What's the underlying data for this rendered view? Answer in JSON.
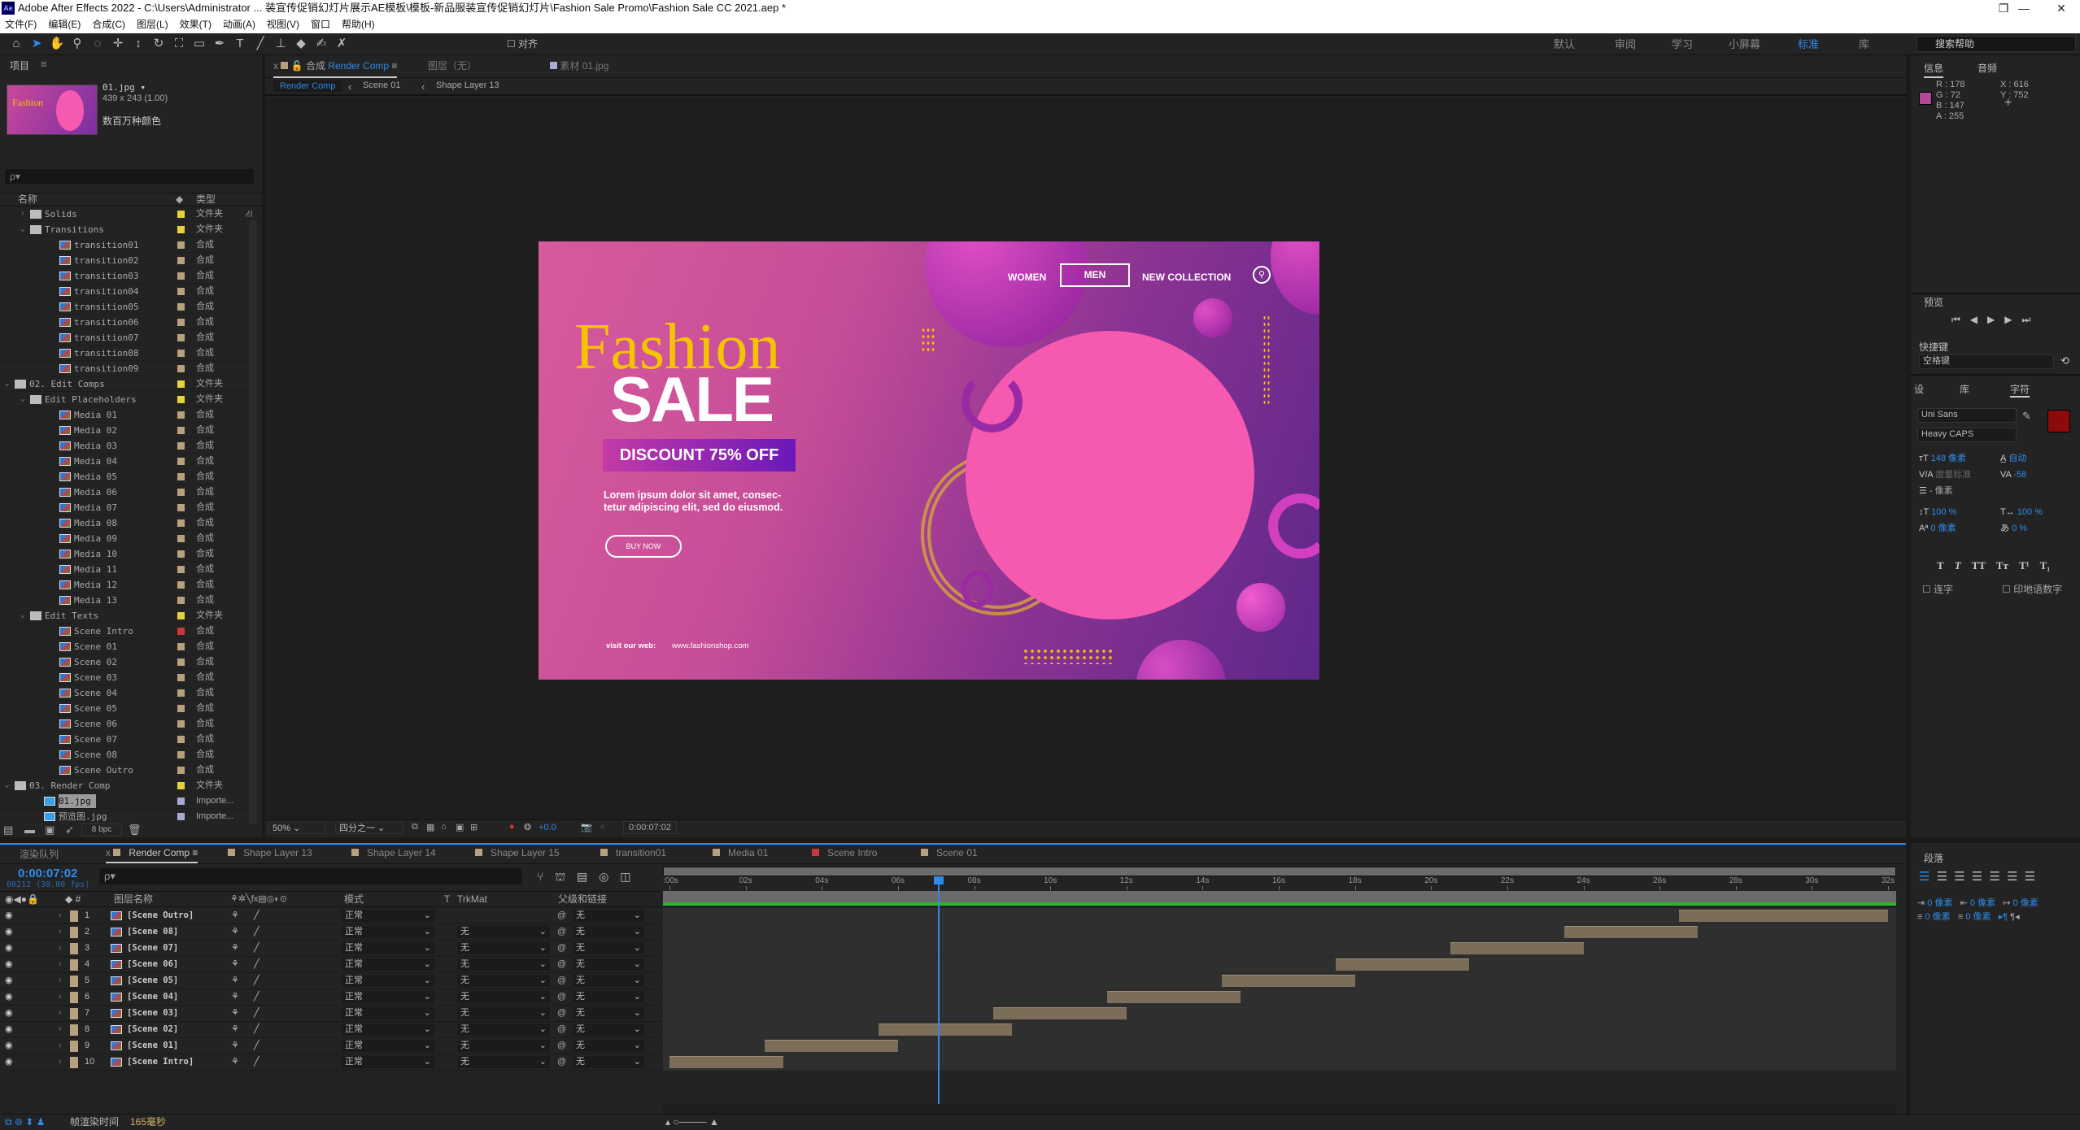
{
  "window": {
    "title": "Adobe After Effects 2022 - C:\\Users\\Administrator ... 装宣传促销幻灯片展示AE模板\\模板-新品服装宣传促销幻灯片\\Fashion Sale Promo\\Fashion Sale CC 2021.aep *",
    "logo": "Ae",
    "controls": [
      "—",
      "❐",
      "✕"
    ]
  },
  "menu": [
    "文件(F)",
    "编辑(E)",
    "合成(C)",
    "图层(L)",
    "效果(T)",
    "动画(A)",
    "视图(V)",
    "窗口",
    "帮助(H)"
  ],
  "toolbar": {
    "align_label": "对齐",
    "workspaces": [
      "默认",
      "审阅",
      "学习",
      "小屏幕",
      "标准",
      "库"
    ],
    "active_workspace": "标准",
    "help_placeholder": "搜索帮助"
  },
  "project": {
    "title": "项目",
    "thumb_name": "01.jpg ▾",
    "thumb_dims": "439 x 243 (1.00)",
    "thumb_colors": "数百万种颜色",
    "search_placeholder": "ρ▾",
    "col_name": "名称",
    "col_type": "类型",
    "bpc": "8 bpc",
    "items": [
      {
        "name": "Solids",
        "kind": "folder",
        "depth": 1,
        "open": false,
        "label": "#e6d23c",
        "type": "文件夹"
      },
      {
        "name": "Transitions",
        "kind": "folder",
        "depth": 1,
        "open": true,
        "label": "#e6d23c",
        "type": "文件夹"
      },
      {
        "name": "transition01",
        "kind": "comp",
        "depth": 2,
        "label": "#b7a17e",
        "type": "合成"
      },
      {
        "name": "transition02",
        "kind": "comp",
        "depth": 2,
        "label": "#b7a17e",
        "type": "合成"
      },
      {
        "name": "transition03",
        "kind": "comp",
        "depth": 2,
        "label": "#b7a17e",
        "type": "合成"
      },
      {
        "name": "transition04",
        "kind": "comp",
        "depth": 2,
        "label": "#b7a17e",
        "type": "合成"
      },
      {
        "name": "transition05",
        "kind": "comp",
        "depth": 2,
        "label": "#b7a17e",
        "type": "合成"
      },
      {
        "name": "transition06",
        "kind": "comp",
        "depth": 2,
        "label": "#b7a17e",
        "type": "合成"
      },
      {
        "name": "transition07",
        "kind": "comp",
        "depth": 2,
        "label": "#b7a17e",
        "type": "合成"
      },
      {
        "name": "transition08",
        "kind": "comp",
        "depth": 2,
        "label": "#b7a17e",
        "type": "合成"
      },
      {
        "name": "transition09",
        "kind": "comp",
        "depth": 2,
        "label": "#b7a17e",
        "type": "合成"
      },
      {
        "name": "02. Edit Comps",
        "kind": "folder",
        "depth": 0,
        "open": true,
        "label": "#e6d23c",
        "type": "文件夹"
      },
      {
        "name": "Edit Placeholders",
        "kind": "folder",
        "depth": 1,
        "open": true,
        "label": "#e6d23c",
        "type": "文件夹"
      },
      {
        "name": "Media 01",
        "kind": "comp",
        "depth": 2,
        "label": "#b7a17e",
        "type": "合成"
      },
      {
        "name": "Media 02",
        "kind": "comp",
        "depth": 2,
        "label": "#b7a17e",
        "type": "合成"
      },
      {
        "name": "Media 03",
        "kind": "comp",
        "depth": 2,
        "label": "#b7a17e",
        "type": "合成"
      },
      {
        "name": "Media 04",
        "kind": "comp",
        "depth": 2,
        "label": "#b7a17e",
        "type": "合成"
      },
      {
        "name": "Media 05",
        "kind": "comp",
        "depth": 2,
        "label": "#b7a17e",
        "type": "合成"
      },
      {
        "name": "Media 06",
        "kind": "comp",
        "depth": 2,
        "label": "#b7a17e",
        "type": "合成"
      },
      {
        "name": "Media 07",
        "kind": "comp",
        "depth": 2,
        "label": "#b7a17e",
        "type": "合成"
      },
      {
        "name": "Media 08",
        "kind": "comp",
        "depth": 2,
        "label": "#b7a17e",
        "type": "合成"
      },
      {
        "name": "Media 09",
        "kind": "comp",
        "depth": 2,
        "label": "#b7a17e",
        "type": "合成"
      },
      {
        "name": "Media 10",
        "kind": "comp",
        "depth": 2,
        "label": "#b7a17e",
        "type": "合成"
      },
      {
        "name": "Media 11",
        "kind": "comp",
        "depth": 2,
        "label": "#b7a17e",
        "type": "合成"
      },
      {
        "name": "Media 12",
        "kind": "comp",
        "depth": 2,
        "label": "#b7a17e",
        "type": "合成"
      },
      {
        "name": "Media 13",
        "kind": "comp",
        "depth": 2,
        "label": "#b7a17e",
        "type": "合成"
      },
      {
        "name": "Edit Texts",
        "kind": "folder",
        "depth": 1,
        "open": true,
        "label": "#e6d23c",
        "type": "文件夹"
      },
      {
        "name": "Scene Intro",
        "kind": "comp",
        "depth": 2,
        "label": "#c43a3a",
        "type": "合成"
      },
      {
        "name": "Scene 01",
        "kind": "comp",
        "depth": 2,
        "label": "#b7a17e",
        "type": "合成"
      },
      {
        "name": "Scene 02",
        "kind": "comp",
        "depth": 2,
        "label": "#b7a17e",
        "type": "合成"
      },
      {
        "name": "Scene 03",
        "kind": "comp",
        "depth": 2,
        "label": "#b7a17e",
        "type": "合成"
      },
      {
        "name": "Scene 04",
        "kind": "comp",
        "depth": 2,
        "label": "#b7a17e",
        "type": "合成"
      },
      {
        "name": "Scene 05",
        "kind": "comp",
        "depth": 2,
        "label": "#b7a17e",
        "type": "合成"
      },
      {
        "name": "Scene 06",
        "kind": "comp",
        "depth": 2,
        "label": "#b7a17e",
        "type": "合成"
      },
      {
        "name": "Scene 07",
        "kind": "comp",
        "depth": 2,
        "label": "#b7a17e",
        "type": "合成"
      },
      {
        "name": "Scene 08",
        "kind": "comp",
        "depth": 2,
        "label": "#b7a17e",
        "type": "合成"
      },
      {
        "name": "Scene Outro",
        "kind": "comp",
        "depth": 2,
        "label": "#b7a17e",
        "type": "合成"
      },
      {
        "name": "03. Render Comp",
        "kind": "folder",
        "depth": 0,
        "open": true,
        "label": "#e6d23c",
        "type": "文件夹"
      },
      {
        "name": "01.jpg",
        "kind": "img",
        "depth": 1,
        "label": "#a9a9d6",
        "type": "Importe...",
        "selected": true
      },
      {
        "name": "预览图.jpg",
        "kind": "img",
        "depth": 1,
        "label": "#a9a9d6",
        "type": "Importe..."
      }
    ]
  },
  "viewer": {
    "tabs": [
      {
        "prefix": "合成",
        "label": "Render Comp",
        "active": true
      },
      {
        "label": "图层（无）"
      },
      {
        "prefix": "素材",
        "label": "01.jpg"
      }
    ],
    "breadcrumbs": [
      "Render Comp",
      "Scene 01",
      "Shape Layer 13"
    ],
    "zoom": "50%",
    "resolution": "四分之一",
    "exposure": "+0.0",
    "timecode": "0:00:07:02"
  },
  "banner": {
    "nav": [
      "WOMEN",
      "MEN",
      "NEW COLLECTION"
    ],
    "active_nav": "MEN",
    "title_script": "Fashion",
    "title_main": "SALE",
    "discount": "DISCOUNT 75% OFF",
    "body1": "Lorem ipsum dolor sit amet, consec-",
    "body2": "tetur adipiscing elit, sed do eiusmod.",
    "cta": "BUY NOW",
    "web_label": "visit our web:",
    "web_url": "www.fashionshop.com",
    "colors": {
      "pink": "#f55ab0",
      "gold": "#f5c400",
      "purple": "#5d278a"
    }
  },
  "info": {
    "tabs": [
      "信息",
      "音频"
    ],
    "r": "R : 178",
    "g": "G : 72",
    "b": "B : 147",
    "a": "A : 255",
    "x": "X : 616",
    "y": "Y : 752",
    "swatch": "#b24893"
  },
  "preview": {
    "title": "预览",
    "shortcut_label": "快捷键",
    "shortcut": "空格键"
  },
  "character": {
    "tabs": [
      "设",
      "库",
      "字符"
    ],
    "font": "Uni Sans",
    "style": "Heavy CAPS",
    "size": "148 像素",
    "leading": "自动",
    "kerning": "度量标准",
    "tracking": "-58",
    "stroke": "- 像素",
    "vscale": "100 %",
    "hscale": "100 %",
    "baseline": "0 像素",
    "tsume": "0 %",
    "ligature": "连字",
    "hindi": "印地语数字",
    "fill": "#8b0a0a"
  },
  "timeline": {
    "tabs": [
      {
        "label": "渲染队列"
      },
      {
        "label": "Render Comp",
        "color": "#b7a17e",
        "active": true
      },
      {
        "label": "Shape Layer 13",
        "color": "#b7a17e"
      },
      {
        "label": "Shape Layer 14",
        "color": "#b7a17e"
      },
      {
        "label": "Shape Layer 15",
        "color": "#b7a17e"
      },
      {
        "label": "transition01",
        "color": "#b7a17e"
      },
      {
        "label": "Media 01",
        "color": "#b7a17e"
      },
      {
        "label": "Scene Intro",
        "color": "#c43a3a"
      },
      {
        "label": "Scene 01",
        "color": "#b7a17e"
      }
    ],
    "time": "0:00:07:02",
    "frames": "00212 (30.00 fps)",
    "current_seconds": 7.07,
    "duration": 32,
    "headers": {
      "name": "图层名称",
      "mode": "模式",
      "t": "T",
      "trkmat": "TrkMat",
      "parent": "父级和链接"
    },
    "ticks": [
      ":00s",
      "02s",
      "04s",
      "06s",
      "08s",
      "10s",
      "12s",
      "14s",
      "16s",
      "18s",
      "20s",
      "22s",
      "24s",
      "26s",
      "28s",
      "30s",
      "32s"
    ],
    "layers": [
      {
        "num": "1",
        "name": "[Scene Outro]",
        "mode": "正常",
        "trkmat": "",
        "parent": "无",
        "in": 26.5,
        "out": 32
      },
      {
        "num": "2",
        "name": "[Scene 08]",
        "mode": "正常",
        "trkmat": "无",
        "parent": "无",
        "in": 23.5,
        "out": 27
      },
      {
        "num": "3",
        "name": "[Scene 07]",
        "mode": "正常",
        "trkmat": "无",
        "parent": "无",
        "in": 20.5,
        "out": 24
      },
      {
        "num": "4",
        "name": "[Scene 06]",
        "mode": "正常",
        "trkmat": "无",
        "parent": "无",
        "in": 17.5,
        "out": 21
      },
      {
        "num": "5",
        "name": "[Scene 05]",
        "mode": "正常",
        "trkmat": "无",
        "parent": "无",
        "in": 14.5,
        "out": 18
      },
      {
        "num": "6",
        "name": "[Scene 04]",
        "mode": "正常",
        "trkmat": "无",
        "parent": "无",
        "in": 11.5,
        "out": 15
      },
      {
        "num": "7",
        "name": "[Scene 03]",
        "mode": "正常",
        "trkmat": "无",
        "parent": "无",
        "in": 8.5,
        "out": 12
      },
      {
        "num": "8",
        "name": "[Scene 02]",
        "mode": "正常",
        "trkmat": "无",
        "parent": "无",
        "in": 5.5,
        "out": 9
      },
      {
        "num": "9",
        "name": "[Scene 01]",
        "mode": "正常",
        "trkmat": "无",
        "parent": "无",
        "in": 2.5,
        "out": 6
      },
      {
        "num": "10",
        "name": "[Scene Intro]",
        "mode": "正常",
        "trkmat": "无",
        "parent": "无",
        "in": 0,
        "out": 3
      }
    ]
  },
  "paragraph": {
    "title": "段落",
    "indent_left": "0 像素",
    "indent_right": "0 像素",
    "indent_first": "0 像素",
    "space_before": "0 像素",
    "space_after": "0 像素"
  },
  "status": {
    "label": "帧渲染时间",
    "value": "165毫秒"
  }
}
